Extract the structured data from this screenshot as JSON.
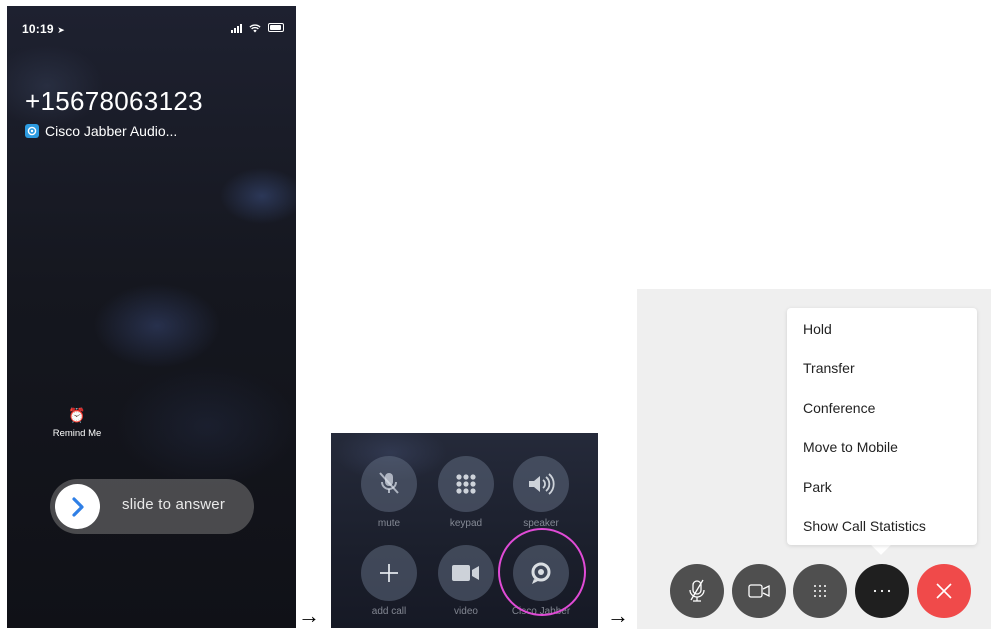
{
  "incoming_call": {
    "status_time": "10:19",
    "caller_number": "+15678063123",
    "app_label": "Cisco Jabber Audio...",
    "remind_label": "Remind Me",
    "slide_label": "slide to answer"
  },
  "arrows": [
    "→",
    "→"
  ],
  "call_controls": {
    "buttons": [
      {
        "label": "mute",
        "icon": "mute-icon"
      },
      {
        "label": "keypad",
        "icon": "keypad-icon"
      },
      {
        "label": "speaker",
        "icon": "speaker-icon"
      },
      {
        "label": "add call",
        "icon": "plus-icon"
      },
      {
        "label": "video",
        "icon": "video-icon"
      },
      {
        "label": "Cisco Jabber",
        "icon": "cisco-jabber-icon"
      }
    ],
    "highlight_color": "#e04bd6"
  },
  "jabber_menu": {
    "items": [
      "Hold",
      "Transfer",
      "Conference",
      "Move to Mobile",
      "Park",
      "Show Call Statistics"
    ],
    "controls": [
      {
        "name": "mute",
        "icon": "mic-off-icon"
      },
      {
        "name": "video",
        "icon": "video-icon"
      },
      {
        "name": "keypad",
        "icon": "keypad-icon"
      },
      {
        "name": "more",
        "icon": "more-icon"
      },
      {
        "name": "end call",
        "icon": "close-icon"
      }
    ],
    "end_call_color": "#f04a4a"
  }
}
